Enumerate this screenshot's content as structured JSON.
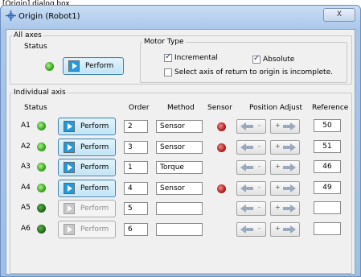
{
  "caption": "[Origin] dialog box",
  "window": {
    "title": "Origin (Robot1)",
    "close_label": "X"
  },
  "all_axes": {
    "legend": "All axes",
    "status_label": "Status",
    "perform_label": "Perform",
    "motor_type": {
      "legend": "Motor Type",
      "incremental": {
        "label": "Incremental",
        "checked": true
      },
      "absolute": {
        "label": "Absolute",
        "checked": true
      },
      "incomplete": {
        "label": "Select axis of return to origin is incomplete.",
        "checked": false
      }
    }
  },
  "individual_axis": {
    "legend": "Individual axis",
    "headers": {
      "status": "Status",
      "order": "Order",
      "method": "Method",
      "sensor": "Sensor",
      "position_adjust": "Position Adjust",
      "reference": "Reference"
    },
    "minus_label": "-",
    "plus_label": "+",
    "rows": [
      {
        "axis": "A1",
        "perform": "Perform",
        "order": "2",
        "method": "Sensor",
        "sensor": "red",
        "reference": "50",
        "enabled": true,
        "status": "green"
      },
      {
        "axis": "A2",
        "perform": "Perform",
        "order": "3",
        "method": "Sensor",
        "sensor": "red",
        "reference": "51",
        "enabled": true,
        "status": "green"
      },
      {
        "axis": "A3",
        "perform": "Perform",
        "order": "1",
        "method": "Torque",
        "sensor": "",
        "reference": "46",
        "enabled": true,
        "status": "green"
      },
      {
        "axis": "A4",
        "perform": "Perform",
        "order": "4",
        "method": "Sensor",
        "sensor": "red",
        "reference": "49",
        "enabled": true,
        "status": "green"
      },
      {
        "axis": "A5",
        "perform": "Perform",
        "order": "5",
        "method": "",
        "sensor": "",
        "reference": "",
        "enabled": false,
        "status": "dark"
      },
      {
        "axis": "A6",
        "perform": "Perform",
        "order": "6",
        "method": "",
        "sensor": "",
        "reference": "",
        "enabled": false,
        "status": "dark"
      }
    ]
  }
}
